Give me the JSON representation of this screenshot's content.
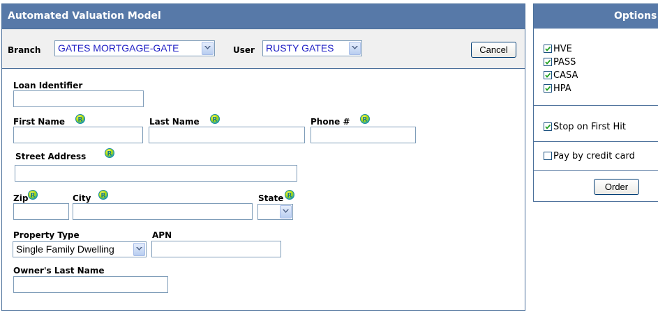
{
  "avm": {
    "title": "Automated Valuation Model",
    "branch_label": "Branch",
    "branch_value": "GATES MORTGAGE-GATE",
    "user_label": "User",
    "user_value": "RUSTY GATES",
    "cancel_label": "Cancel",
    "fields": {
      "loan_identifier": "Loan Identifier",
      "first_name": "First Name",
      "last_name": "Last Name",
      "phone": "Phone #",
      "street_address": "Street Address",
      "zip": "Zip",
      "city": "City",
      "state": "State",
      "property_type": "Property Type",
      "property_type_value": "Single Family Dwelling",
      "apn": "APN",
      "owner_last_name": "Owner's Last Name"
    }
  },
  "options": {
    "title": "Options",
    "items": [
      {
        "label": "HVE",
        "checked": true
      },
      {
        "label": "PASS",
        "checked": true
      },
      {
        "label": "CASA",
        "checked": true
      },
      {
        "label": "HPA",
        "checked": true
      }
    ],
    "stop_on_first_hit": {
      "label": "Stop on First Hit",
      "checked": true
    },
    "pay_by_credit_card": {
      "label": "Pay by credit card",
      "checked": false
    },
    "order_label": "Order"
  },
  "colors": {
    "header_bg": "#5779a8",
    "border": "#4a6f9a",
    "toolbar_bg": "#f0f0f0",
    "select_text": "#1c1cc4"
  },
  "icons": {
    "required": "r-circle-icon",
    "dropdown": "chevron-down-icon",
    "check": "checkmark-icon"
  }
}
